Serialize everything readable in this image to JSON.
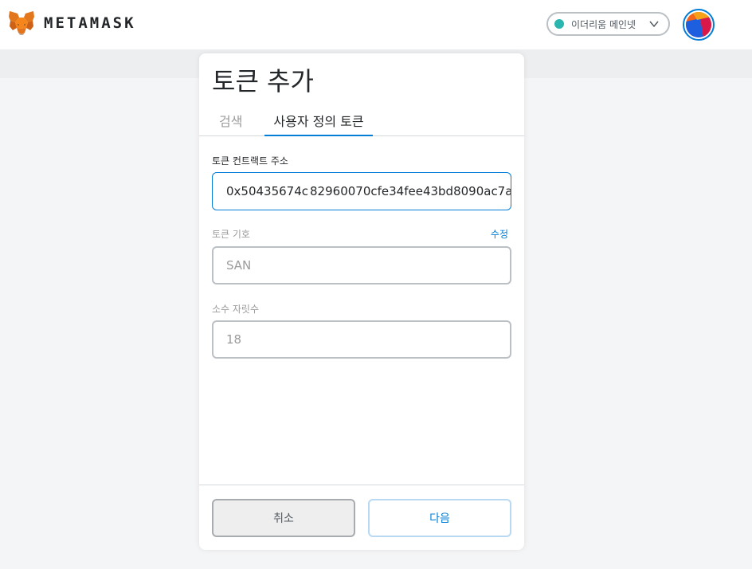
{
  "header": {
    "brand": "METAMASK",
    "network_label": "이더리움 메인넷",
    "colors": {
      "network_dot": "#29b6af",
      "accent": "#037dd6"
    }
  },
  "page": {
    "title": "토큰 추가",
    "tabs": [
      {
        "label": "검색",
        "active": false
      },
      {
        "label": "사용자 정의 토큰",
        "active": true
      }
    ]
  },
  "form": {
    "address": {
      "label": "토큰 컨트랙트 주소",
      "value_before_cursor": "0x50435674c",
      "value_after_cursor": "82960070cfe34fee43bd8090ac7a"
    },
    "symbol": {
      "label": "토큰 기호",
      "edit_label": "수정",
      "value": "SAN"
    },
    "decimals": {
      "label": "소수 자릿수",
      "value": "18"
    }
  },
  "footer": {
    "cancel_label": "취소",
    "next_label": "다음"
  }
}
